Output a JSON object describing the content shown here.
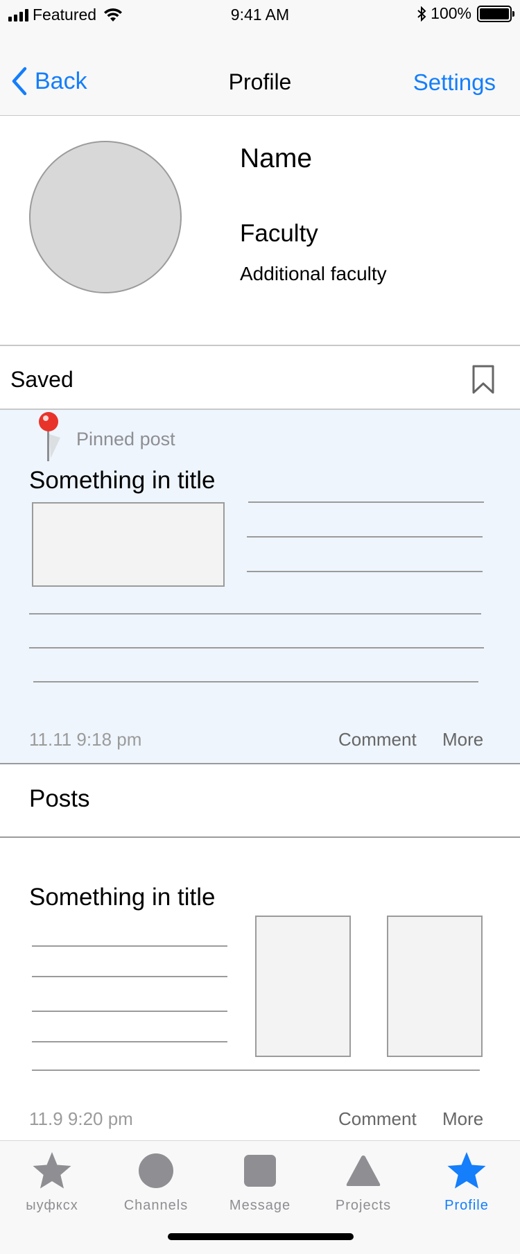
{
  "status_bar": {
    "carrier": "Featured",
    "time": "9:41 AM",
    "battery": "100%",
    "icons": [
      "signal-icon",
      "wifi-icon",
      "bluetooth-icon",
      "battery-icon"
    ]
  },
  "nav": {
    "back_label": "Back",
    "title": "Profile",
    "settings_label": "Settings",
    "accent_color": "#147efb"
  },
  "profile": {
    "name": "Name",
    "faculty": "Faculty",
    "additional_faculty": "Additional faculty"
  },
  "saved": {
    "label": "Saved",
    "icon": "bookmark-icon"
  },
  "pinned_post": {
    "badge": "Pinned post",
    "title": "Something in title",
    "timestamp": "11.11 9:18 pm",
    "comment_label": "Comment",
    "more_label": "More"
  },
  "posts": {
    "header": "Posts",
    "items": [
      {
        "title": "Something in title",
        "timestamp": "11.9 9:20 pm",
        "comment_label": "Comment",
        "more_label": "More"
      }
    ]
  },
  "tab_bar": {
    "items": [
      {
        "label": "ыуфксх",
        "icon": "star-icon",
        "active": false
      },
      {
        "label": "Channels",
        "icon": "circle-icon",
        "active": false
      },
      {
        "label": "Message",
        "icon": "square-icon",
        "active": false
      },
      {
        "label": "Projects",
        "icon": "triangle-icon",
        "active": false
      },
      {
        "label": "Profile",
        "icon": "star-icon",
        "active": true
      }
    ]
  }
}
